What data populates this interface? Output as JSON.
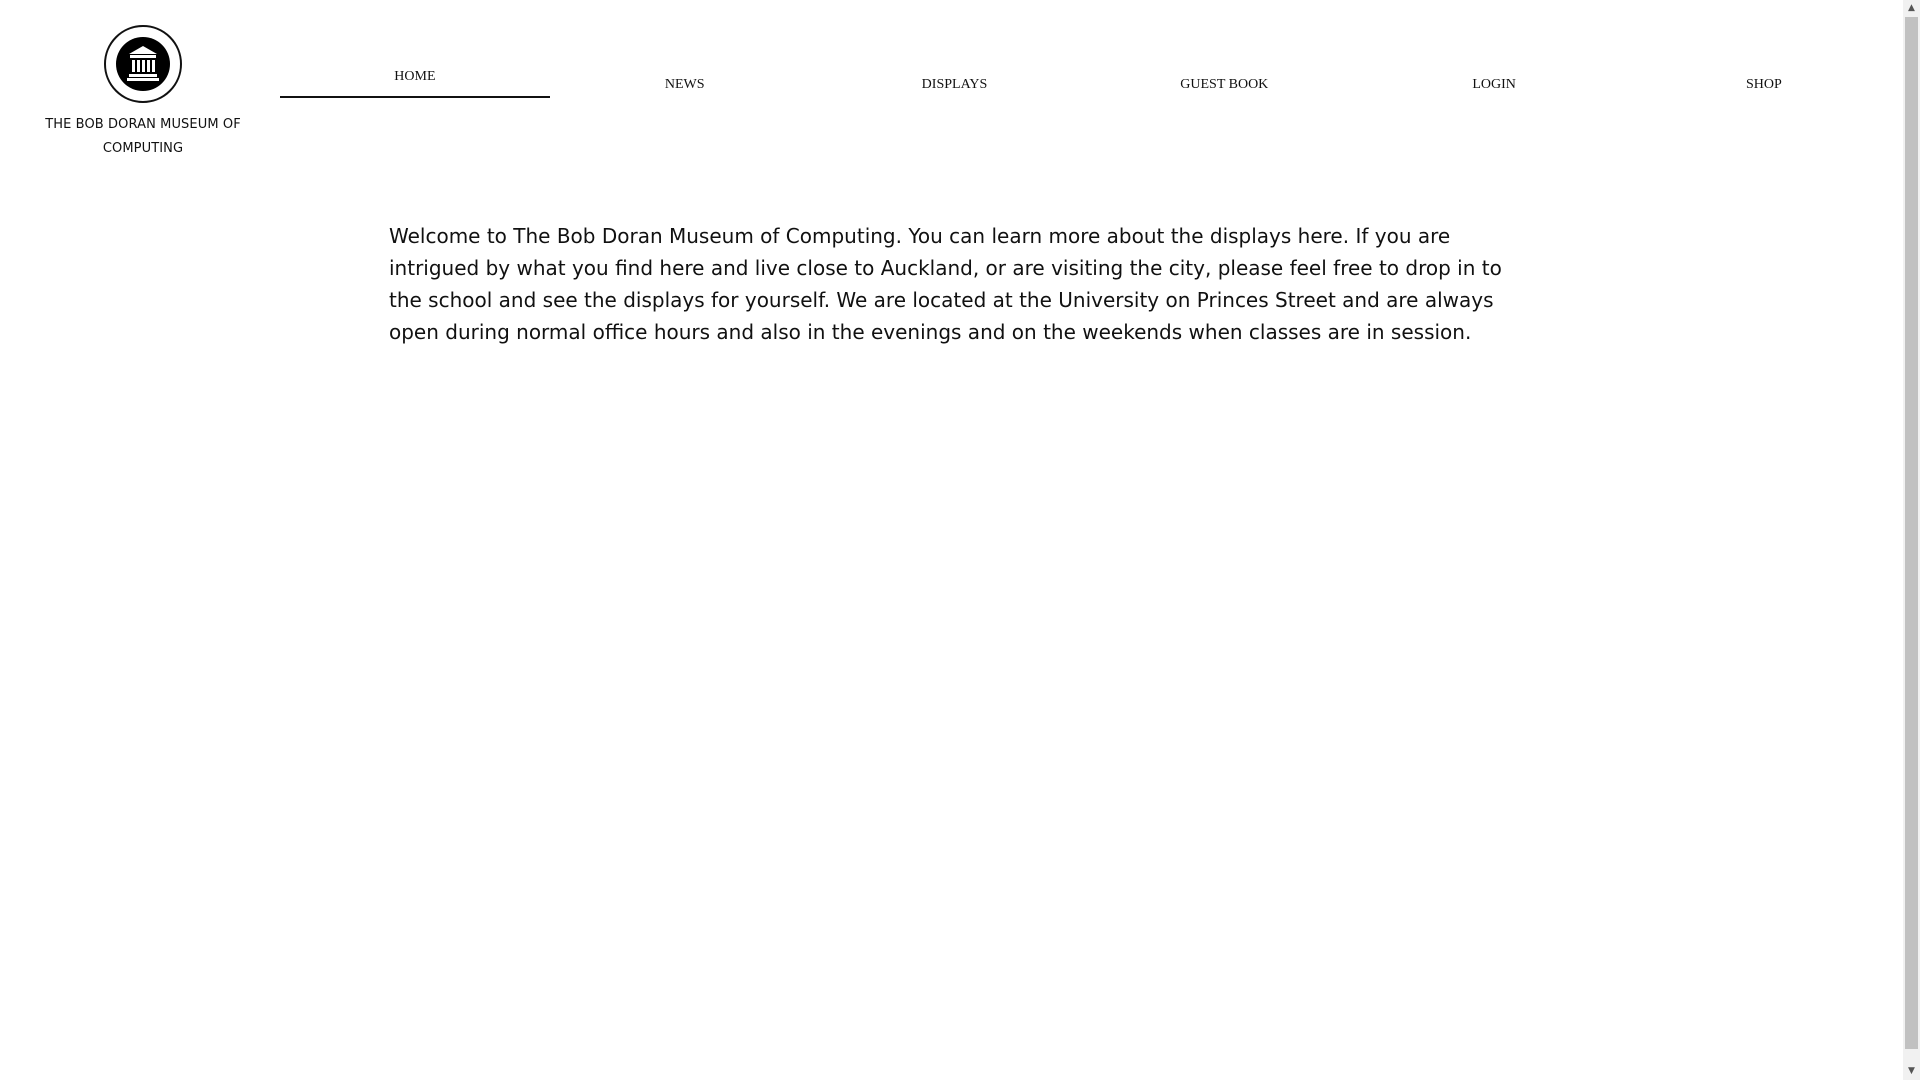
{
  "logo": {
    "icon": "museum-icon",
    "title": "THE BOB DORAN MUSEUM OF COMPUTING"
  },
  "nav": {
    "items": [
      {
        "label": "HOME",
        "active": true
      },
      {
        "label": "NEWS",
        "active": false
      },
      {
        "label": "DISPLAYS",
        "active": false
      },
      {
        "label": "GUEST BOOK",
        "active": false
      },
      {
        "label": "LOGIN",
        "active": false
      },
      {
        "label": "SHOP",
        "active": false
      }
    ]
  },
  "main": {
    "intro": "Welcome to The Bob Doran Museum of Computing. You can learn more about the displays here. If you are intrigued by what you find here and live close to Auckland, or are visiting the city, please feel free to drop in to the school and see the displays for yourself. We are located at the University on Princes Street and are always open during normal office hours and also in the evenings and on the weekends when classes are in session."
  },
  "scrollbar": {
    "up_icon": "▲",
    "down_icon": "▼"
  }
}
